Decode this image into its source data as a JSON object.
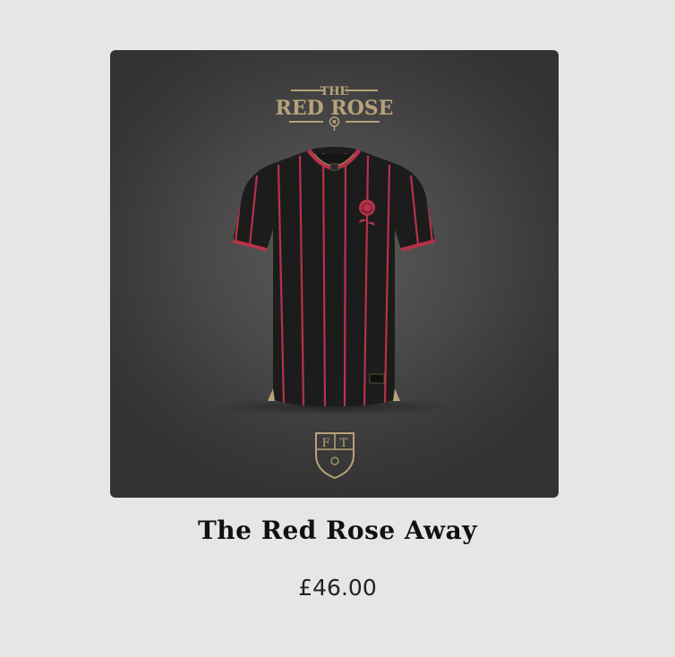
{
  "product": {
    "image": {
      "brand_logo": {
        "line1": "THE",
        "line2": "RED ROSE"
      },
      "crest_letters": {
        "left": "F",
        "right": "T"
      }
    },
    "title": "The Red Rose Away",
    "price": "£46.00"
  },
  "colors": {
    "page_background": "#e6e6e6",
    "image_background": "#4a4a4a",
    "logo_gold": "#b8a27a",
    "shirt_black": "#1c1c1c",
    "pinstripe_red": "#b8324a",
    "rose_red": "#b8324a"
  },
  "icons": {
    "rose_emblem": "rose-icon",
    "crest": "ft-shield-crest-icon"
  }
}
